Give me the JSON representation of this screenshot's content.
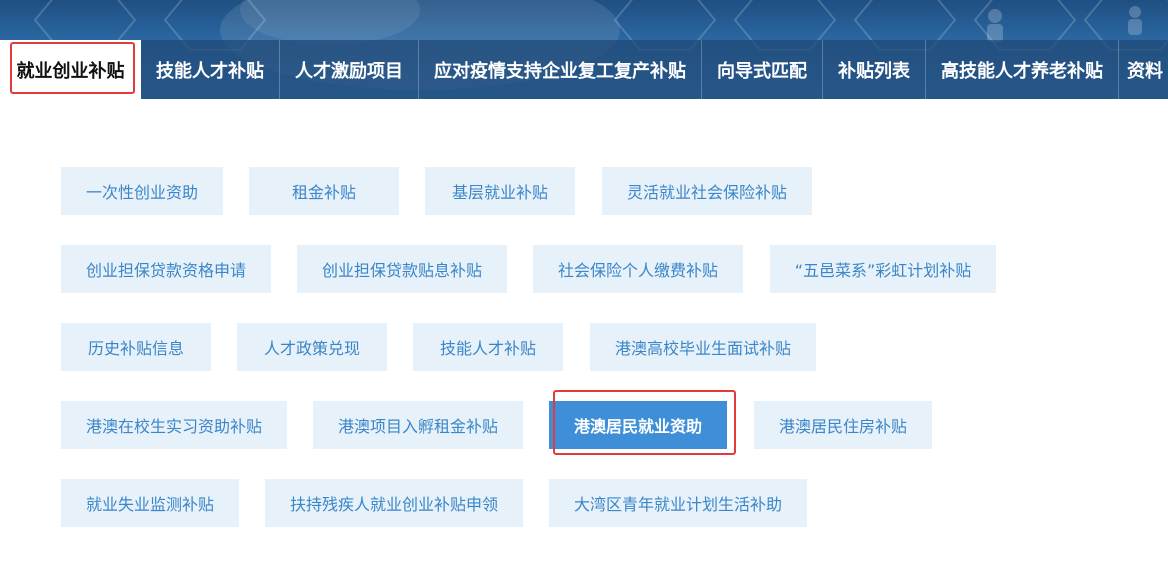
{
  "tabs": [
    {
      "label": "就业创业补贴",
      "active": true
    },
    {
      "label": "技能人才补贴",
      "active": false
    },
    {
      "label": "人才激励项目",
      "active": false
    },
    {
      "label": "应对疫情支持企业复工复产补贴",
      "active": false
    },
    {
      "label": "向导式匹配",
      "active": false
    },
    {
      "label": "补贴列表",
      "active": false
    },
    {
      "label": "高技能人才养老补贴",
      "active": false
    },
    {
      "label": "资料",
      "active": false
    }
  ],
  "subsidies": [
    {
      "label": "一次性创业资助"
    },
    {
      "label": "租金补贴"
    },
    {
      "label": "基层就业补贴"
    },
    {
      "label": "灵活就业社会保险补贴"
    },
    {
      "label": "创业担保贷款资格申请"
    },
    {
      "label": "创业担保贷款贴息补贴"
    },
    {
      "label": "社会保险个人缴费补贴"
    },
    {
      "label": "“五邑菜系”彩虹计划补贴"
    },
    {
      "label": "历史补贴信息"
    },
    {
      "label": "人才政策兑现"
    },
    {
      "label": "技能人才补贴"
    },
    {
      "label": "港澳高校毕业生面试补贴"
    },
    {
      "label": "港澳在校生实习资助补贴"
    },
    {
      "label": "港澳项目入孵租金补贴"
    },
    {
      "label": "港澳居民就业资助",
      "selected": true
    },
    {
      "label": "港澳居民住房补贴"
    },
    {
      "label": "就业失业监测补贴"
    },
    {
      "label": "扶持残疾人就业创业补贴申领"
    },
    {
      "label": "大湾区青年就业计划生活补助"
    }
  ],
  "colors": {
    "accent": "#3e8fd8",
    "chip_bg": "#e7f1fa",
    "chip_text": "#3a86c8",
    "highlight": "#e23b3b"
  }
}
